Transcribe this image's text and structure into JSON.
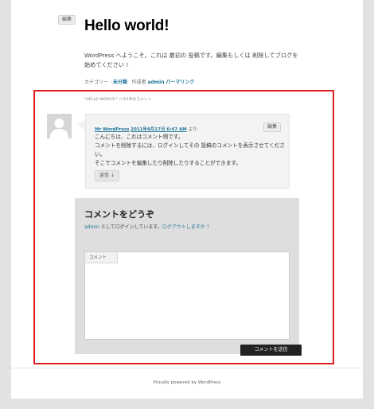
{
  "post": {
    "edit_label": "編集",
    "title": "Hello world!",
    "body": "WordPress へようこそ。これは 最初の 投稿です。編集もしくは 削除してブログを始めてください !",
    "meta_prefix": "カテゴリー :",
    "category": "未分類",
    "author_prefix": "作成者",
    "author": "admin",
    "permalink": "パーマリンク"
  },
  "comments": {
    "title": "\"HELLO WORLD!\" への1件のコメント",
    "items": [
      {
        "author": "Mr WordPress",
        "date": "2011年9月17日 6:47 AM",
        "said": "より:",
        "edit_label": "編集",
        "lines": [
          "こんにちは、これはコメント例です。",
          "コメントを削除するには、ログインしてその 投稿のコメントを表示させてください。",
          "そこでコメントを編集したり削除したりすることができます。"
        ],
        "reply_label": "返信 ↓"
      }
    ]
  },
  "respond": {
    "title": "コメントをどうぞ",
    "logged_in_user": "admin",
    "logged_in_text": " としてログインしています。",
    "logout_link": "ログアウトしますか ?",
    "textarea_label": "コメント",
    "textarea_value": "",
    "submit_label": "コメントを送信"
  },
  "footer": {
    "credit": "Proudly powered by WordPress"
  },
  "colors": {
    "link": "#21759b",
    "highlight_border": "#e02020"
  }
}
